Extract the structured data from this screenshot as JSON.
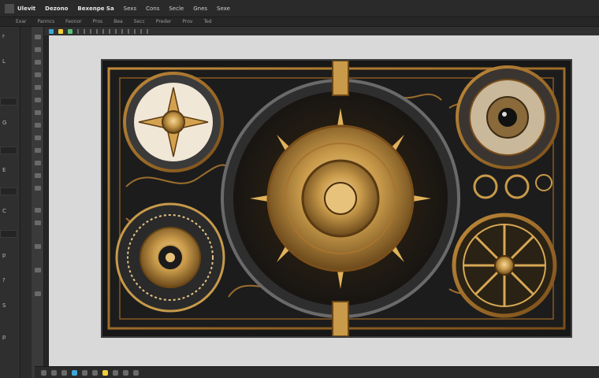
{
  "menubar": {
    "items": [
      "Ulevit",
      "Dezono",
      "Bexenpe Sa",
      "Sexs",
      "Cons",
      "Secle",
      "Gnes",
      "Sexe"
    ]
  },
  "options": [
    "Exar",
    "Parmcs",
    "Feonor",
    "Pros",
    "Bea",
    "Secc",
    "Preder",
    "Prov",
    "Ted"
  ],
  "left_panel": {
    "labels": [
      "r",
      "L",
      "G",
      "E",
      "C",
      "p",
      "?",
      "S",
      "p"
    ]
  },
  "colors": {
    "accent": "#c89a4a",
    "swatch_blue": "#3aa9d6",
    "swatch_yellow": "#f0cf3a",
    "swatch_green": "#5bc47a"
  },
  "icons": {
    "swatches": [
      "blue",
      "yellow",
      "green"
    ]
  }
}
